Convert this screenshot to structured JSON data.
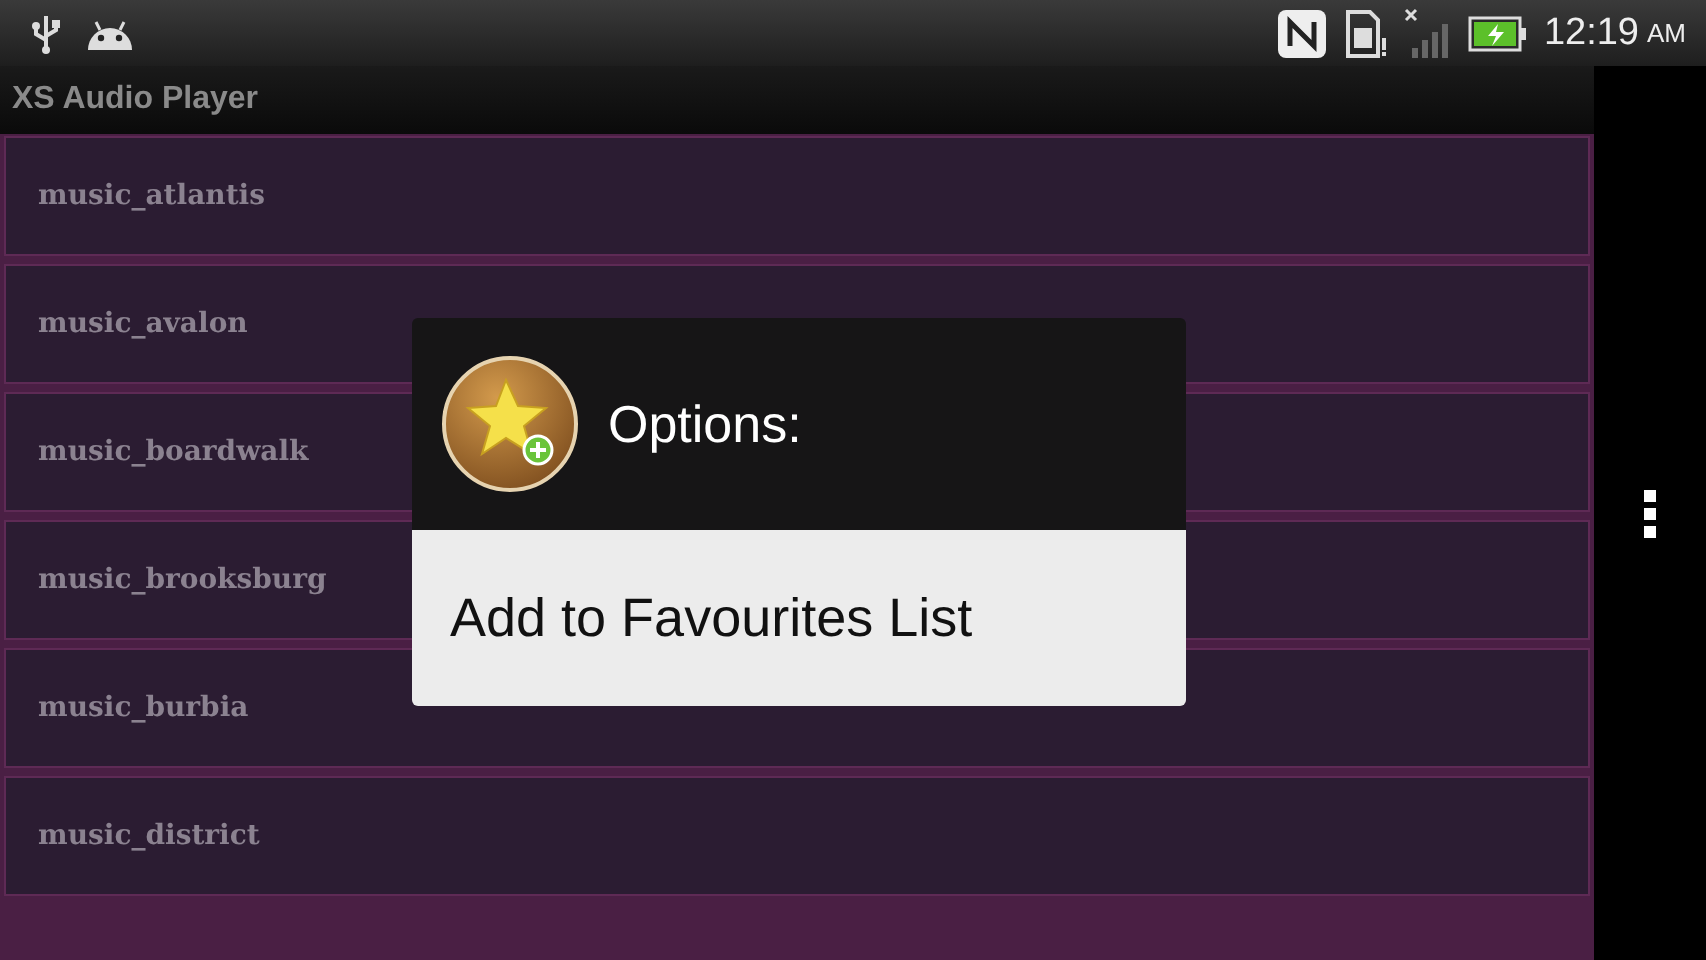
{
  "status_bar": {
    "time": "12:19",
    "meridiem": "AM"
  },
  "action_bar": {
    "title": "XS Audio Player"
  },
  "tracks": [
    {
      "name": "music_atlantis"
    },
    {
      "name": "music_avalon"
    },
    {
      "name": "music_boardwalk"
    },
    {
      "name": "music_brooksburg"
    },
    {
      "name": "music_burbia"
    },
    {
      "name": "music_district"
    }
  ],
  "dialog": {
    "title": "Options:",
    "items": [
      {
        "label": "Add to Favourites List"
      }
    ]
  }
}
